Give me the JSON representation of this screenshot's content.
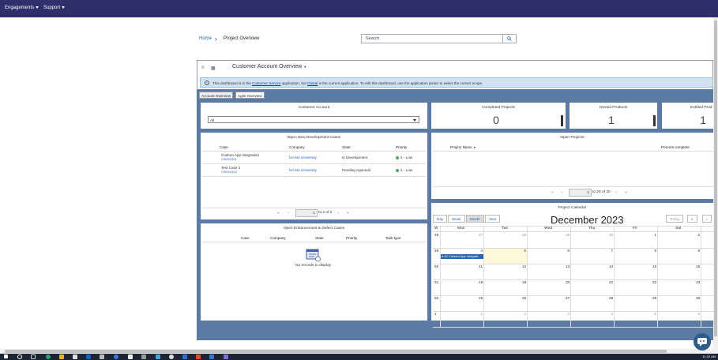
{
  "topbar": {
    "engagements": "Engagements",
    "support": "Support"
  },
  "breadcrumb": {
    "home": "Home",
    "current": "Project Overview"
  },
  "search": {
    "placeholder": "Search"
  },
  "dashboard": {
    "title": "Customer Account Overview",
    "info": {
      "p1": "This dashboard is in the",
      "app": "Customer Service",
      "p2": "application, but",
      "scope": "Global",
      "p3": "is the current application. To edit this dashboard, use the application picker to select the correct scope."
    },
    "tabs": [
      "Account Overview",
      "Agile Overview"
    ]
  },
  "customer_account": {
    "title": "Customer Account",
    "selected": "All"
  },
  "completed_projects": {
    "title": "Completed Projects",
    "value": "0"
  },
  "owned_products": {
    "title": "Owned Products",
    "value": "1"
  },
  "entitled_products": {
    "title": "Entitled Prod",
    "value": "1"
  },
  "dev_cases": {
    "title": "Open New Development Cases",
    "headers": [
      "Case",
      "Company",
      "State",
      "Priority"
    ],
    "rows": [
      {
        "case": "Custom App Integration",
        "number": "CS0001011",
        "company": "De Mo University",
        "state": "In Development",
        "priority": "4 - Low"
      },
      {
        "case": "Test Case 2",
        "number": "CS0001012",
        "company": "De Mo University",
        "state": "Pending Approval",
        "priority": "4 - Low"
      }
    ],
    "pager": {
      "page": "1",
      "of": "to 2 of 2"
    }
  },
  "open_projects": {
    "title": "Open Projects",
    "headers": [
      "Project Name",
      "Percent complete"
    ],
    "pager": {
      "page": "1",
      "of": "to 20 of 20"
    }
  },
  "enh_cases": {
    "title": "Open Enhancement & Defect Cases",
    "headers": [
      "Case",
      "Company",
      "State",
      "Priority",
      "Task type"
    ],
    "empty": "No records to display"
  },
  "calendar": {
    "title": "Project Calendar",
    "views": [
      "Day",
      "Week",
      "Month",
      "Year"
    ],
    "month": "December 2023",
    "today": "Today",
    "prev_year": "«",
    "prev": "‹",
    "headers": [
      "W",
      "Mon",
      "Tue",
      "Wed",
      "Thu",
      "Fri",
      "Sat"
    ],
    "weeks": [
      {
        "w": "48",
        "days": [
          "27",
          "28",
          "29",
          "30",
          "1",
          "2"
        ]
      },
      {
        "w": "49",
        "days": [
          "4",
          "5",
          "6",
          "7",
          "8",
          "9"
        ]
      },
      {
        "w": "50",
        "days": [
          "11",
          "12",
          "13",
          "14",
          "15",
          "16"
        ]
      },
      {
        "w": "51",
        "days": [
          "18",
          "19",
          "20",
          "21",
          "22",
          "23"
        ]
      },
      {
        "w": "52",
        "days": [
          "25",
          "26",
          "27",
          "28",
          "29",
          "30"
        ]
      },
      {
        "w": "1",
        "days": [
          "1",
          "2",
          "3",
          "4",
          "5",
          "6"
        ]
      }
    ],
    "event": "8:42 Custom App Integrati..."
  },
  "taskbar": {
    "clock": "11:22 AM"
  }
}
